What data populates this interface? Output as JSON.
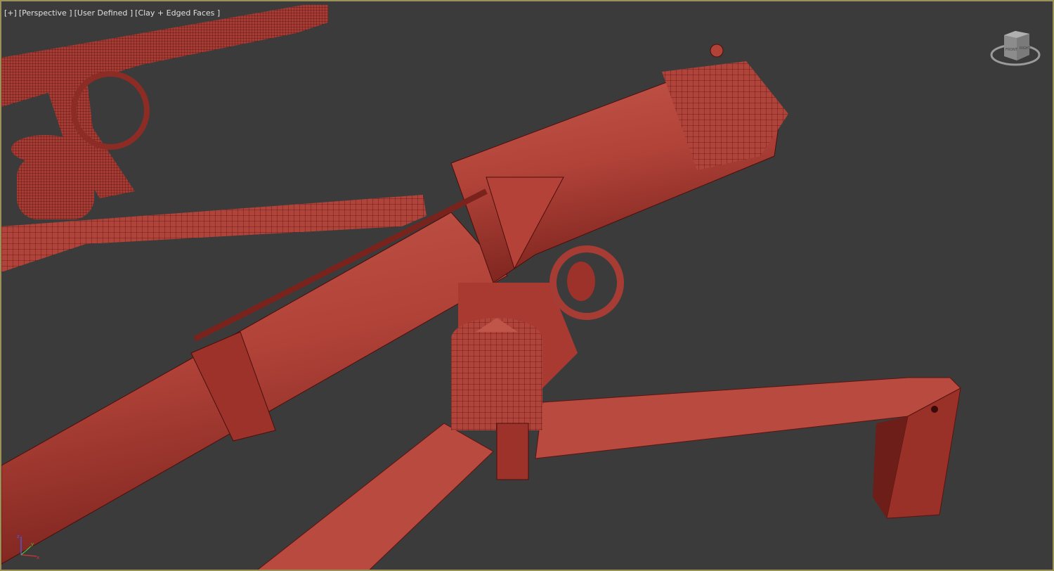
{
  "viewport": {
    "labels": [
      "[+]",
      "[Perspective ]",
      "[User Defined ]",
      "[Clay + Edged Faces ]"
    ],
    "viewcube": {
      "front_label": "FRONT",
      "right_label": "RIGHT"
    },
    "gizmo_axes": {
      "x": "x",
      "y": "y",
      "z": "z"
    }
  },
  "colors": {
    "border": "#9c9258",
    "background": "#3b3b3b",
    "clay": "#b4433a",
    "clay_dark": "#7a231d",
    "edge": "#4a0f0c"
  }
}
